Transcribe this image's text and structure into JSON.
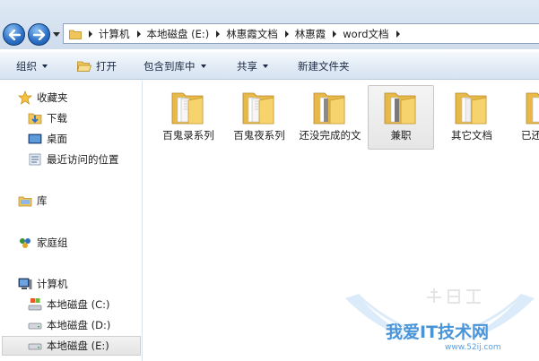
{
  "address_bar": {
    "breadcrumbs": [
      "计算机",
      "本地磁盘 (E:)",
      "林惠霞文档",
      "林惠霞",
      "word文档"
    ]
  },
  "toolbar": {
    "organize_label": "组织",
    "open_label": "打开",
    "include_in_library_label": "包含到库中",
    "share_label": "共享",
    "new_folder_label": "新建文件夹"
  },
  "nav_pane": {
    "favorites": "收藏夹",
    "downloads": "下载",
    "desktop": "桌面",
    "recent_places": "最近访问的位置",
    "libraries": "库",
    "homegroup": "家庭组",
    "computer": "计算机",
    "drive_c": "本地磁盘 (C:)",
    "drive_d": "本地磁盘 (D:)",
    "drive_e": "本地磁盘 (E:)"
  },
  "content": {
    "items": [
      {
        "label": "百鬼录系列",
        "icon": "folder-icon"
      },
      {
        "label": "百鬼夜系列",
        "icon": "folder-icon"
      },
      {
        "label": "还没完成的文",
        "icon": "folder-icon"
      },
      {
        "label": "兼职",
        "icon": "folder-icon",
        "selected": true
      },
      {
        "label": "其它文档",
        "icon": "folder-icon"
      },
      {
        "label": "已还",
        "icon": "folder-icon"
      }
    ]
  },
  "watermark": {
    "title": "我爱IT技术网",
    "url": "www.52ij.com"
  },
  "colors": {
    "toolbar_bg": "#dde8f4",
    "folder_yellow": "#f2cf6b",
    "nav_button_blue": "#2f74c9",
    "watermark_blue": "#4a94d8"
  }
}
